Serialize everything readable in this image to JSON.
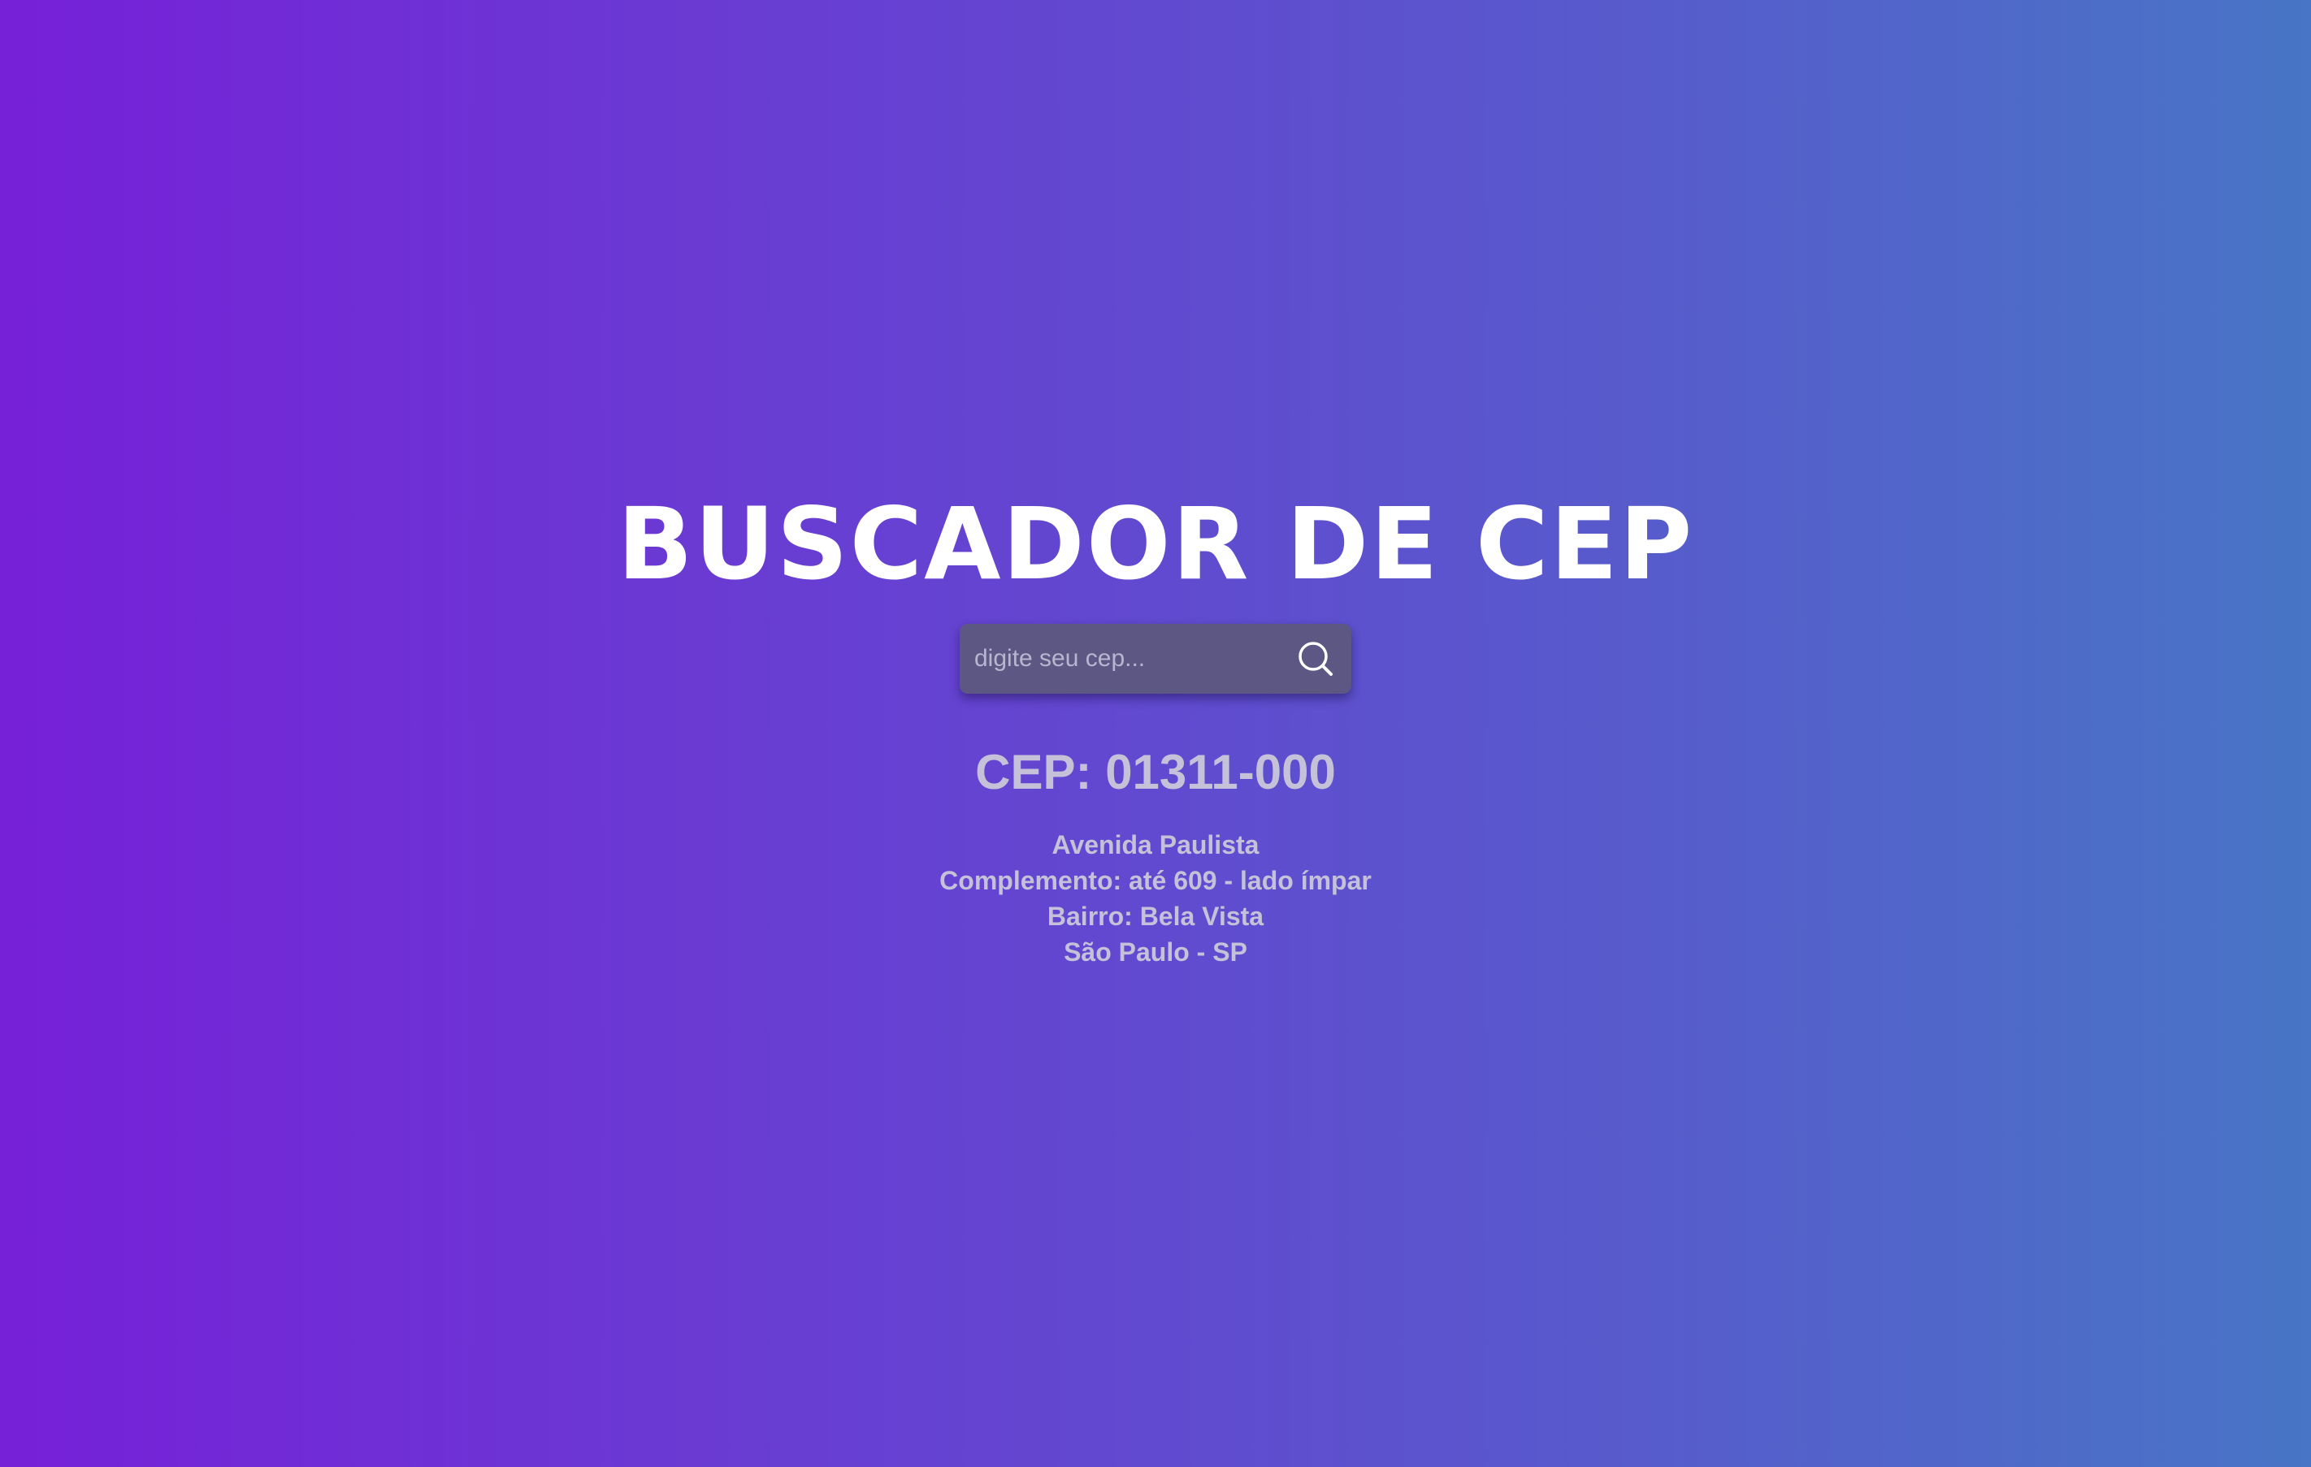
{
  "app": {
    "title": "BUSCADOR DE CEP"
  },
  "search": {
    "placeholder": "digite seu cep...",
    "value": "",
    "button_icon": "search-icon"
  },
  "result": {
    "cep_heading": "CEP: 01311-000",
    "logradouro": "Avenida Paulista",
    "complemento": "Complemento: até 609 - lado ímpar",
    "bairro": "Bairro: Bela Vista",
    "cidade_uf": "São Paulo - SP"
  },
  "colors": {
    "gradient_start": "#7620d8",
    "gradient_end": "#4875c6",
    "search_box_bg": "#5d5883",
    "result_text": "#c4c1d8",
    "title_text": "#ffffff"
  }
}
